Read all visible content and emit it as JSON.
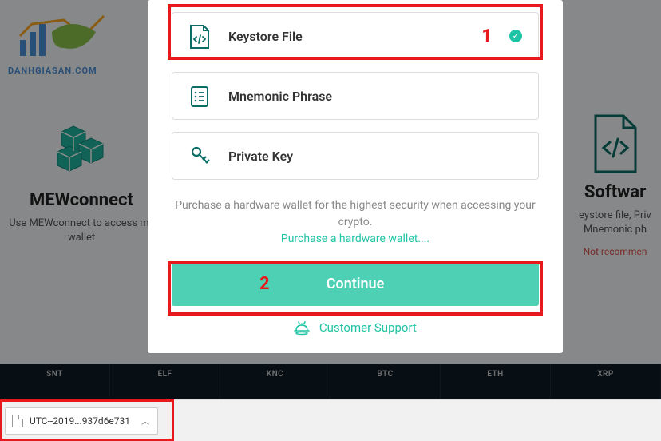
{
  "background": {
    "logo_text": "DANHGIASAN.COM",
    "left_card": {
      "title": "MEWconnect",
      "desc": "Use MEWconnect to access my wallet"
    },
    "right_card": {
      "title": "Softwar",
      "desc": "eystore file, Priv Mnemonic ph",
      "warn": "Not recommen"
    }
  },
  "modal": {
    "options": [
      {
        "label": "Keystore File",
        "selected": true,
        "annot": "1"
      },
      {
        "label": "Mnemonic Phrase",
        "selected": false
      },
      {
        "label": "Private Key",
        "selected": false
      }
    ],
    "purchase_text": "Purchase a hardware wallet for the highest security when accessing your crypto.",
    "purchase_link": "Purchase a hardware wallet....",
    "continue": "Continue",
    "continue_annot": "2",
    "support": "Customer Support"
  },
  "ticker": [
    {
      "sym": "SNT"
    },
    {
      "sym": "ELF"
    },
    {
      "sym": "KNC"
    },
    {
      "sym": "BTC"
    },
    {
      "sym": "ETH"
    },
    {
      "sym": "XRP"
    }
  ],
  "download": {
    "file": "UTC--2019...937d6e731"
  }
}
